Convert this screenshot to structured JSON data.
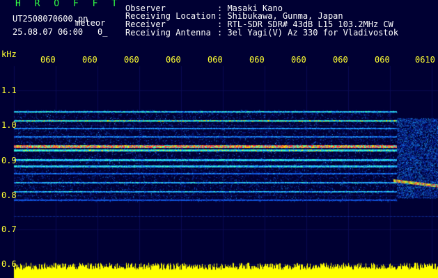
{
  "header": {
    "app_title": "H R O F F T",
    "file_name": "UT2508070600.pn",
    "meteor_label": "meteor",
    "datetime": "25.08.07 06:00",
    "count": "0_"
  },
  "info": [
    {
      "label": "Observer",
      "value": ": Masaki Kano"
    },
    {
      "label": "Receiving Location",
      "value": ": Shibukawa, Gunma, Japan"
    },
    {
      "label": "Receiver",
      "value": ": RTL-SDR SDR# 43dB L15 103.2MHz CW"
    },
    {
      "label": "Receiving Antenna",
      "value": ": 3el Yagi(V) Az 330 for Vladivostok"
    }
  ],
  "axis": {
    "y_unit": "kHz",
    "y_ticks": [
      "1.1",
      "1.0",
      "0.9",
      "0.8",
      "0.7",
      "0.6"
    ],
    "x_ticks": [
      "060",
      "060",
      "060",
      "060",
      "060",
      "060",
      "060",
      "060",
      "060",
      "0610"
    ]
  },
  "colors": {
    "background": "#000033",
    "header_title": "#33ff44",
    "info_text": "#ffffff",
    "axis_text": "#ffff33",
    "noise_floor": "#ffff00"
  }
}
